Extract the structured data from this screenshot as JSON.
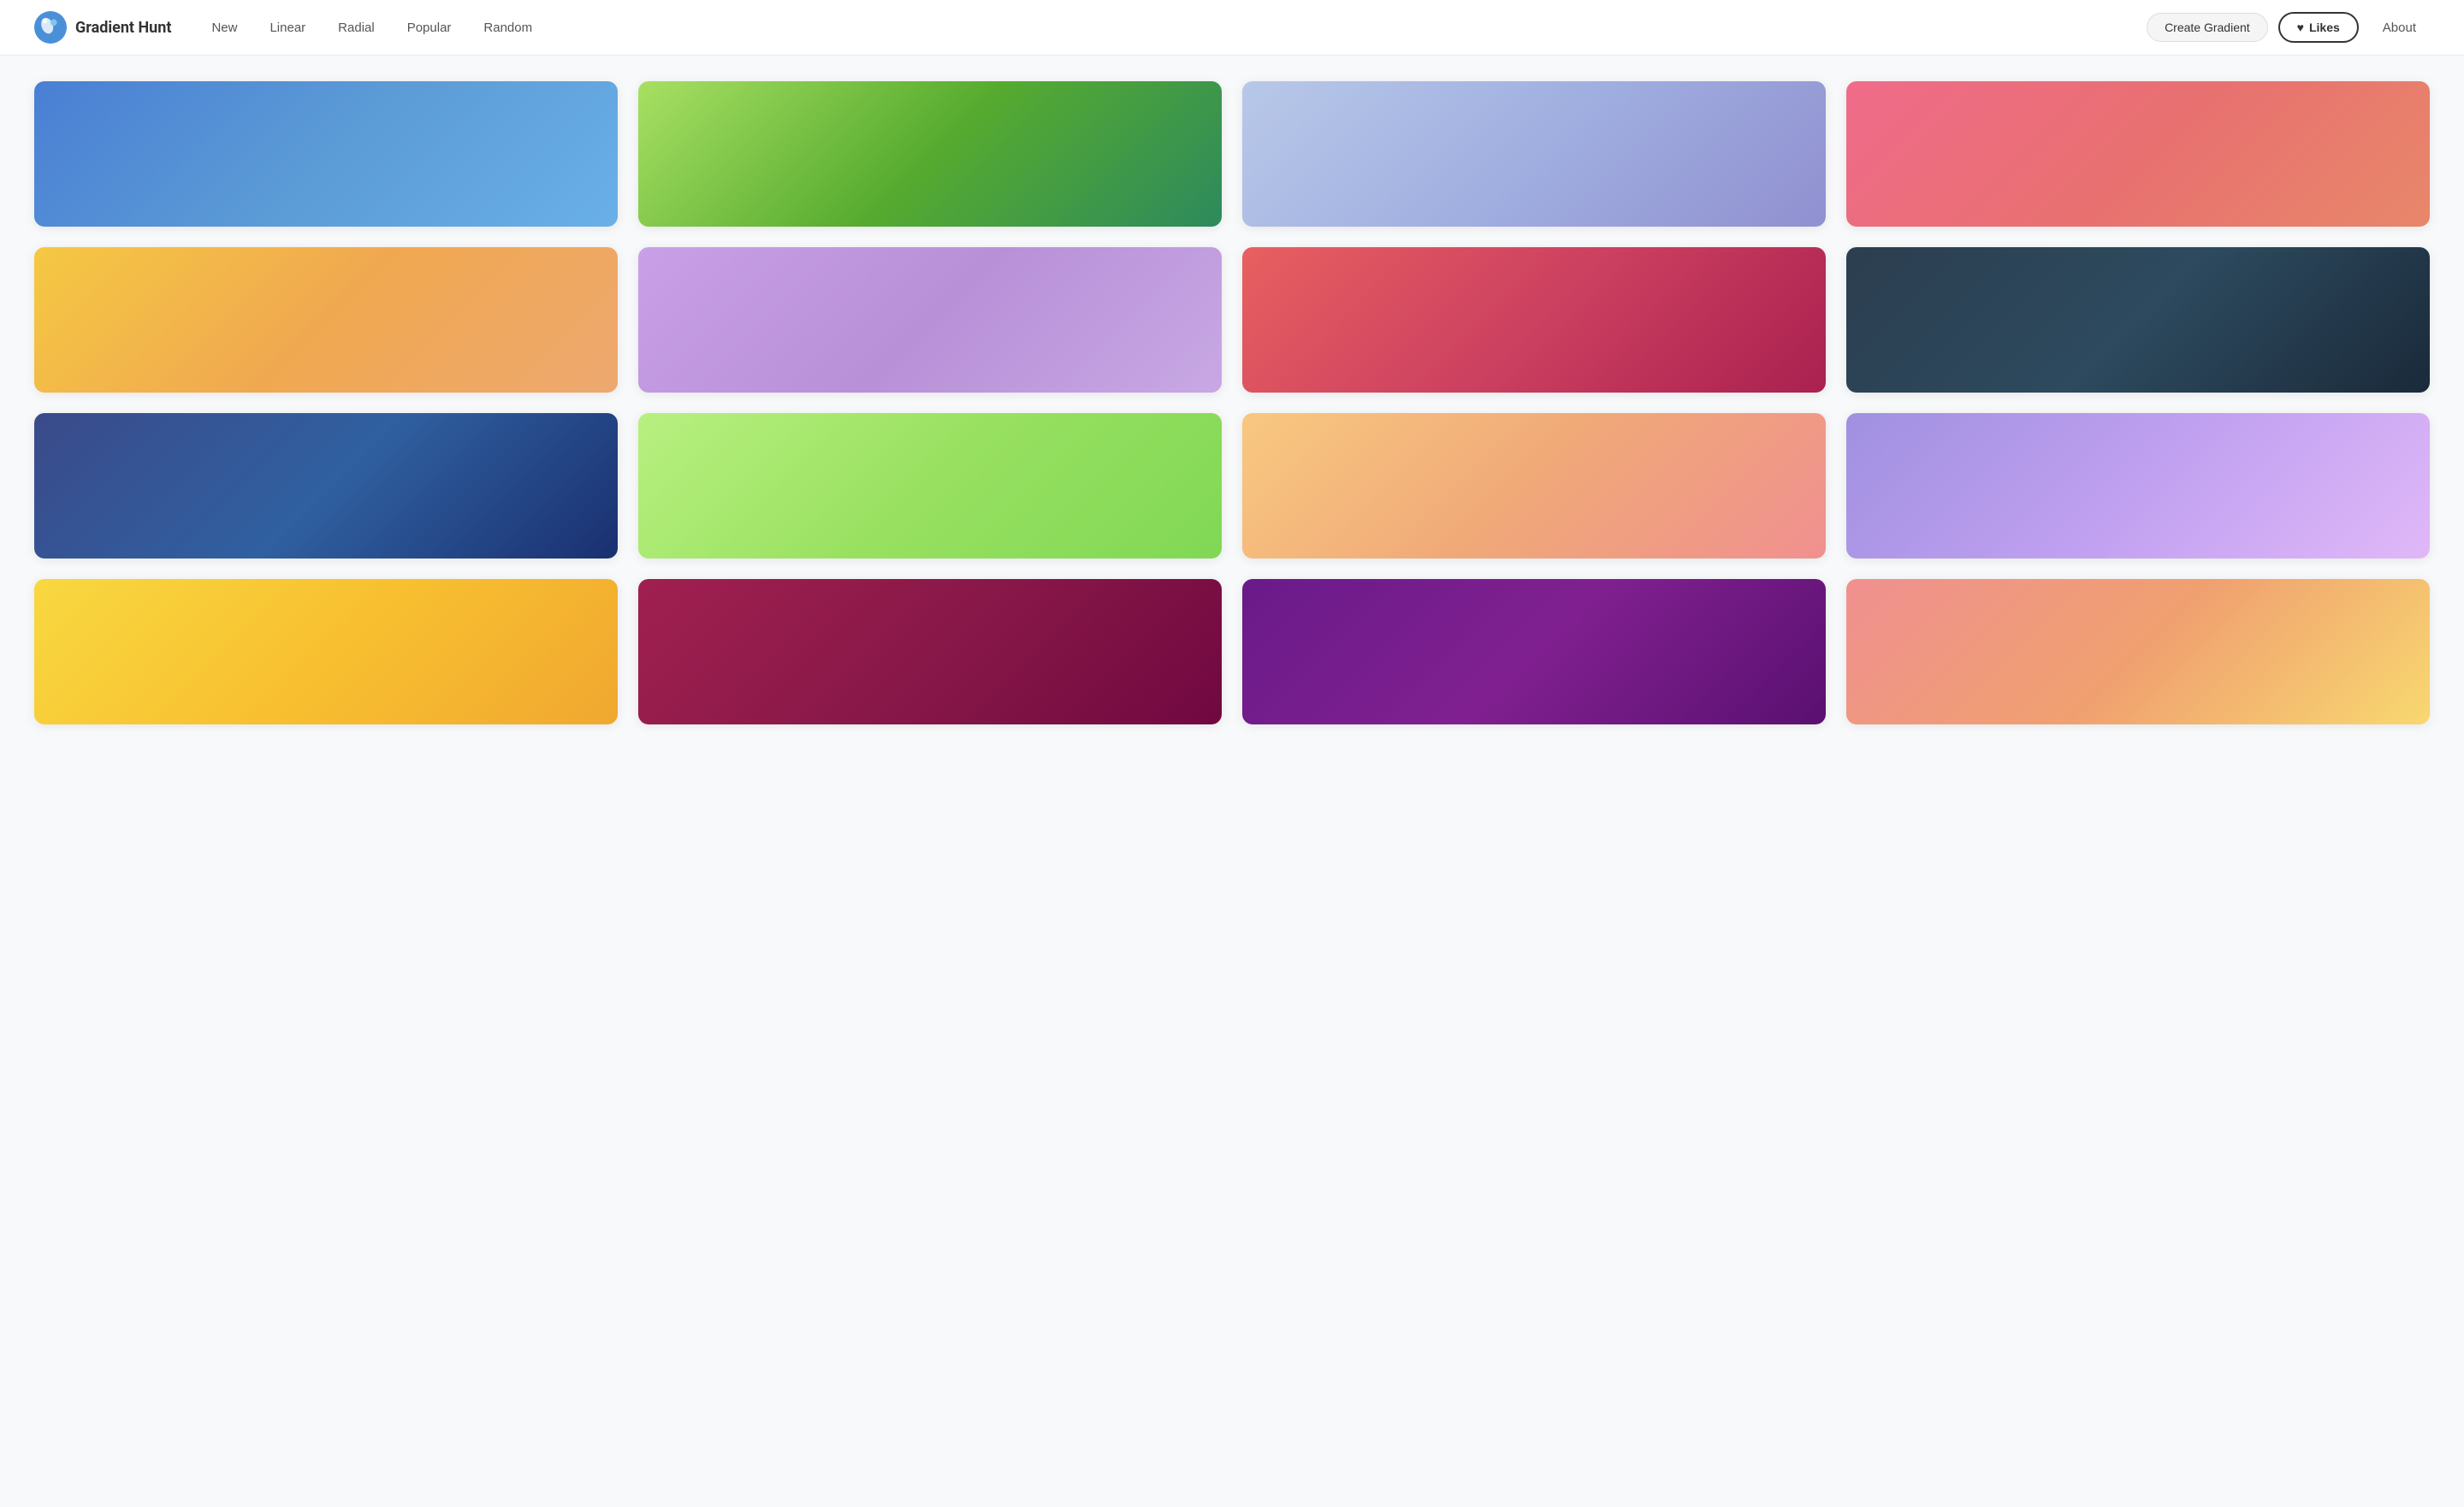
{
  "header": {
    "logo_text": "Gradient Hunt",
    "nav_items": [
      {
        "label": "New",
        "id": "new"
      },
      {
        "label": "Linear",
        "id": "linear"
      },
      {
        "label": "Radial",
        "id": "radial"
      },
      {
        "label": "Popular",
        "id": "popular"
      },
      {
        "label": "Random",
        "id": "random"
      }
    ],
    "create_btn_label": "Create Gradient",
    "likes_btn_label": "Likes",
    "about_link_label": "About"
  },
  "gradients": [
    {
      "id": 1,
      "gradient": "linear-gradient(135deg, #4a7fd4 0%, #5b9bd5 50%, #6baed6 100%)"
    },
    {
      "id": 2,
      "gradient": "linear-gradient(135deg, #a8e063 0%, #56ab2f 100%)"
    },
    {
      "id": 3,
      "gradient": "linear-gradient(135deg, #c5cfe8 0%, #a0a8d8 50%, #8b96d0 100%)"
    },
    {
      "id": 4,
      "gradient": "linear-gradient(135deg, #e8736e 0%, #e88080 50%, #e89090 100%)"
    },
    {
      "id": 5,
      "gradient": "linear-gradient(135deg, #f5c842 0%, #f5a442 50%, #f59060 100%)"
    },
    {
      "id": 6,
      "gradient": "linear-gradient(135deg, #c8a0e8 0%, #b888e0 50%, #c8b0f0 100%)"
    },
    {
      "id": 7,
      "gradient": "linear-gradient(135deg, #e87070 0%, #c84060 50%, #a03050 100%)"
    },
    {
      "id": 8,
      "gradient": "linear-gradient(135deg, #2c4a5a 0%, #1e3545 50%, #182838 100%)"
    },
    {
      "id": 9,
      "gradient": "linear-gradient(135deg, #4a5fa8 0%, #2a4090 50%, #1a3080 100%)"
    },
    {
      "id": 10,
      "gradient": "linear-gradient(135deg, #c8f060 0%, #a0e840 50%, #90d840 100%)"
    },
    {
      "id": 11,
      "gradient": "linear-gradient(135deg, #f8b870 0%, #f898a0 50%, #f07080 100%)"
    },
    {
      "id": 12,
      "gradient": "linear-gradient(135deg, #a8a0e8 0%, #c8b0f0 50%, #e0c8f8 100%)"
    },
    {
      "id": 13,
      "gradient": "linear-gradient(135deg, #f8d040 0%, #f8c030 50%, #f8a820 100%)"
    },
    {
      "id": 14,
      "gradient": "linear-gradient(135deg, #a02040 0%, #902060 50%, #780050 100%)"
    },
    {
      "id": 15,
      "gradient": "linear-gradient(135deg, #6a2080 0%, #8a1090 50%, #6a0870 100%)"
    },
    {
      "id": 16,
      "gradient": "linear-gradient(135deg, #e87878 0%, #f0a070 50%, #f8d060 100%)"
    }
  ]
}
